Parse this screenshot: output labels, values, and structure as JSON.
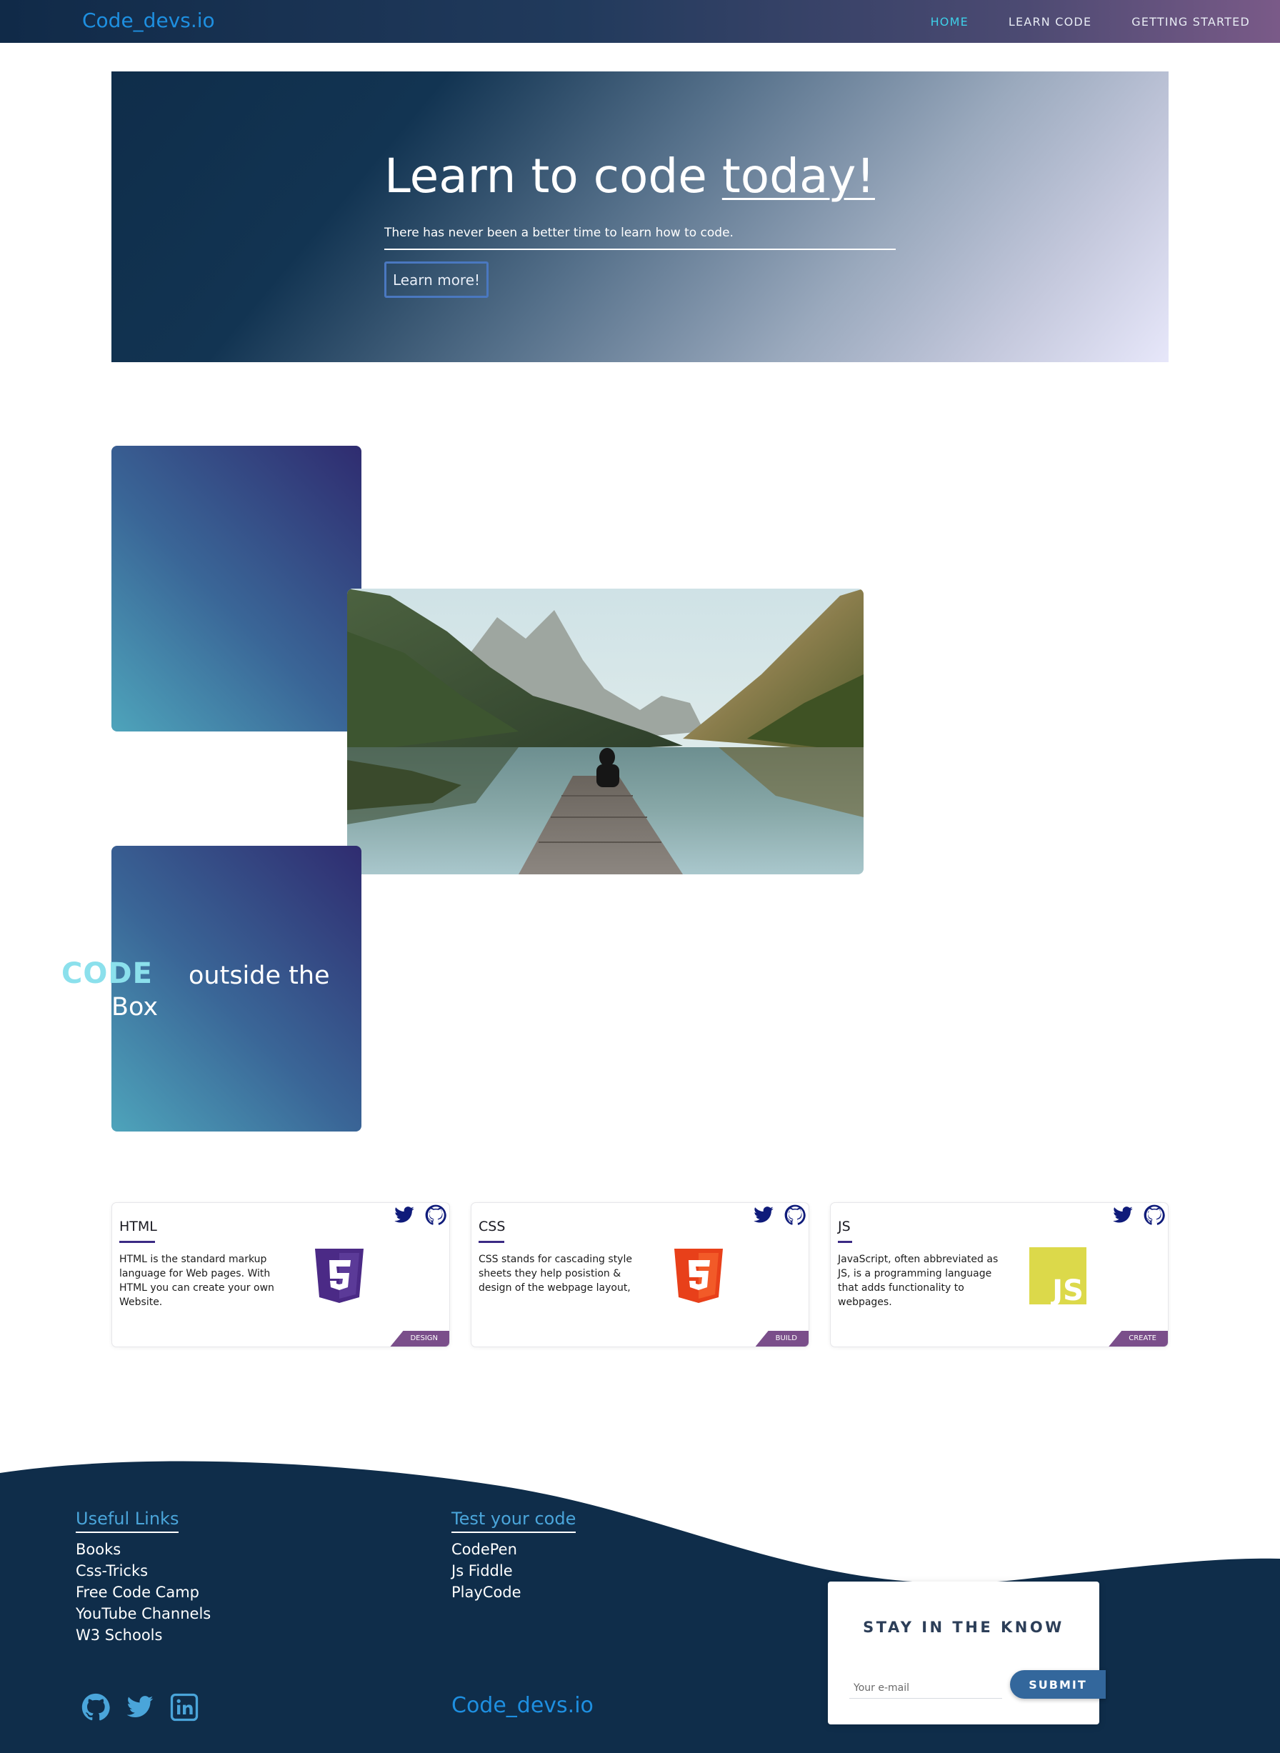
{
  "nav": {
    "brand": "Code_devs.io",
    "links": [
      "HOME",
      "LEARN CODE",
      "GETTING STARTED"
    ]
  },
  "hero": {
    "title_main": "Learn to code ",
    "title_emph": "today!",
    "subtitle": "There has never been a better time to learn how to code.",
    "button_label": "Learn more!"
  },
  "feature": {
    "code_word": "CODE",
    "outside_text": "outside the",
    "box_word": "Box"
  },
  "cards": [
    {
      "title": "HTML",
      "text": "HTML is the standard markup language for Web pages. With HTML you can create your own Website.",
      "tag": "DESIGN",
      "logo": "html5-icon",
      "logo_color": "#4b2a86"
    },
    {
      "title": "CSS",
      "text": "CSS stands for cascading style sheets they help posistion & design of the webpage layout,",
      "tag": "BUILD",
      "logo": "css3-icon",
      "logo_color": "#f0451e"
    },
    {
      "title": "JS",
      "text": "JavaScript, often abbreviated as JS, is a programming language that adds functionality to webpages.",
      "tag": "CREATE",
      "logo": "js-icon",
      "logo_color": "#dcd94a"
    }
  ],
  "footer": {
    "useful_links_title": "Useful Links",
    "useful_links": [
      "Books",
      "Css-Tricks",
      "Free Code Camp",
      "YouTube Channels",
      "W3 Schools"
    ],
    "test_title": "Test your code",
    "test_links": [
      "CodePen",
      "Js Fiddle",
      "PlayCode"
    ],
    "brand": "Code_devs.io",
    "social_icons": [
      "github-icon",
      "twitter-icon",
      "linkedin-icon"
    ]
  },
  "newsletter": {
    "title": "STAY IN THE KNOW",
    "placeholder": "Your e-mail",
    "button_label": "SUBMIT"
  },
  "colors": {
    "navy": "#0f2d4a",
    "accent_blue": "#1e8fe0",
    "nav_active": "#3ed0e8",
    "tag_purple": "#7a4e8a"
  }
}
